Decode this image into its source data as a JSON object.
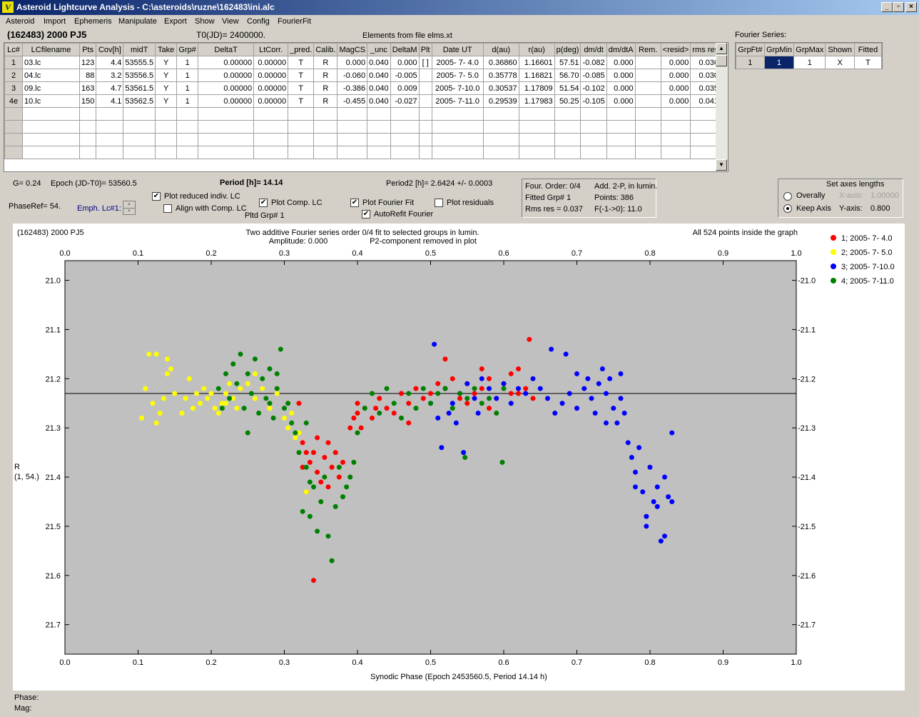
{
  "window": {
    "title": "Asteroid Lightcurve Analysis - C:\\asteroids\\ruzne\\162483\\ini.alc",
    "min": "_",
    "max": "▫",
    "close": "×"
  },
  "menu": [
    "Asteroid",
    "Import",
    "Ephemeris",
    "Manipulate",
    "Export",
    "Show",
    "View",
    "Config",
    "FourierFit"
  ],
  "header": {
    "object": "(162483) 2000 PJ5",
    "t0": "T0(JD)= 2400000.",
    "elements": "Elements from file elms.xt"
  },
  "table": {
    "columns": [
      "Lc#",
      "LCfilename",
      "Pts",
      "Cov[h]",
      "midT",
      "Take",
      "Grp#",
      "DeltaT",
      "LtCorr.",
      "_pred.",
      "Calib.",
      "MagCS",
      "_unc",
      "DeltaM",
      "Plt",
      "Date UT",
      "d(au)",
      "r(au)",
      "p(deg)",
      "dm/dt",
      "dm/dtA",
      "Rem.",
      "<resid>",
      "rms res"
    ],
    "rows": [
      [
        "1",
        "03.lc",
        "123",
        "4.4",
        "53555.5",
        "Y",
        "1",
        "0.00000",
        "0.00000",
        "T",
        "R",
        "0.000",
        "0.040",
        "0.000",
        "[ ]",
        "2005- 7- 4.0",
        "0.36860",
        "1.16601",
        "57.51",
        "-0.082",
        "0.000",
        "",
        "0.000",
        "0.036"
      ],
      [
        "2",
        "04.lc",
        "88",
        "3.2",
        "53556.5",
        "Y",
        "1",
        "0.00000",
        "0.00000",
        "T",
        "R",
        "-0.060",
        "0.040",
        "-0.005",
        "",
        "2005- 7- 5.0",
        "0.35778",
        "1.16821",
        "56.70",
        "-0.085",
        "0.000",
        "",
        "0.000",
        "0.030"
      ],
      [
        "3",
        "09.lc",
        "163",
        "4.7",
        "53561.5",
        "Y",
        "1",
        "0.00000",
        "0.00000",
        "T",
        "R",
        "-0.386",
        "0.040",
        "0.009",
        "",
        "2005- 7-10.0",
        "0.30537",
        "1.17809",
        "51.54",
        "-0.102",
        "0.000",
        "",
        "0.000",
        "0.035"
      ],
      [
        "4e",
        "10.lc",
        "150",
        "4.1",
        "53562.5",
        "Y",
        "1",
        "0.00000",
        "0.00000",
        "T",
        "R",
        "-0.455",
        "0.040",
        "-0.027",
        "",
        "2005- 7-11.0",
        "0.29539",
        "1.17983",
        "50.25",
        "-0.105",
        "0.000",
        "",
        "0.000",
        "0.041"
      ]
    ]
  },
  "fourier": {
    "label": "Fourier Series:",
    "columns": [
      "GrpFt#",
      "GrpMin",
      "GrpMax",
      "Shown",
      "Fitted"
    ],
    "row": [
      "1",
      "1",
      "1",
      "X",
      "T"
    ]
  },
  "controls": {
    "g": "G= 0.24",
    "epoch": "Epoch (JD-T0)= 53560.5",
    "period": "Period [h]= 14.14",
    "period2": "Period2 [h]= 2.6424 +/- 0.0003",
    "phaseref": "PhaseRef= 54.",
    "emph": "Emph. Lc#1:",
    "plot_reduced": "Plot reduced indiv. LC",
    "align": "Align with Comp. LC",
    "plot_comp": "Plot Comp. LC",
    "pltd_grp": "Pltd Grp#  1",
    "plot_fourier": "Plot Fourier Fit",
    "autorefit": "AutoRefit Fourier",
    "plot_resid": "Plot residuals",
    "four_order": "Four. Order:  0/4",
    "add2p": "Add. 2-P, in lumin.",
    "fitted_grp": "Fitted Grp# 1",
    "points": "Points: 386",
    "rms": "Rms res      = 0.037",
    "f10": "F(-1->0):  11.0",
    "axes_title": "Set axes lengths",
    "overally": "Overally",
    "keep_axis": "Keep Axis",
    "xaxis_label": "X-axis:",
    "xaxis_val": "1.00000",
    "yaxis_label": "Y-axis:",
    "yaxis_val": "0.800"
  },
  "plot": {
    "object": "(162483) 2000 PJ5",
    "title1": "Two additive Fourier series order 0/4 fit to selected groups in lumin.",
    "title2": "Amplitude: 0.000",
    "title3": "P2-component removed in plot",
    "inside": "All 524 points inside the graph",
    "ylabel1": "R",
    "ylabel2": "(1, 54.)",
    "xlabel": "Synodic Phase (Epoch 2453560.5, Period 14.14 h)"
  },
  "status": {
    "phase": "Phase:",
    "mag": "Mag:"
  },
  "chart_data": {
    "type": "scatter",
    "xlabel": "Synodic Phase (Epoch 2453560.5, Period 14.14 h)",
    "ylabel": "R (1, 54.)",
    "xlim": [
      0.0,
      1.0
    ],
    "ylim": [
      21.7,
      21.0
    ],
    "xticks": [
      "0.0",
      "0.1",
      "0.2",
      "0.3",
      "0.4",
      "0.5",
      "0.6",
      "0.7",
      "0.8",
      "0.9",
      "1.0"
    ],
    "yticks": [
      "21.0",
      "21.1",
      "21.2",
      "21.3",
      "21.4",
      "21.5",
      "21.6",
      "21.7"
    ],
    "fit_line": 21.23,
    "legend": "top-right",
    "series": [
      {
        "name": "1; 2005- 7- 4.0",
        "color": "#ff0000",
        "points": [
          [
            0.32,
            21.25
          ],
          [
            0.325,
            21.38
          ],
          [
            0.33,
            21.43
          ],
          [
            0.335,
            21.37
          ],
          [
            0.34,
            21.35
          ],
          [
            0.345,
            21.39
          ],
          [
            0.35,
            21.41
          ],
          [
            0.355,
            21.36
          ],
          [
            0.36,
            21.33
          ],
          [
            0.365,
            21.38
          ],
          [
            0.37,
            21.35
          ],
          [
            0.375,
            21.4
          ],
          [
            0.38,
            21.37
          ],
          [
            0.39,
            21.3
          ],
          [
            0.395,
            21.28
          ],
          [
            0.4,
            21.27
          ],
          [
            0.405,
            21.3
          ],
          [
            0.41,
            21.26
          ],
          [
            0.42,
            21.28
          ],
          [
            0.43,
            21.24
          ],
          [
            0.44,
            21.26
          ],
          [
            0.45,
            21.27
          ],
          [
            0.46,
            21.23
          ],
          [
            0.47,
            21.25
          ],
          [
            0.48,
            21.22
          ],
          [
            0.49,
            21.24
          ],
          [
            0.5,
            21.23
          ],
          [
            0.51,
            21.21
          ],
          [
            0.52,
            21.22
          ],
          [
            0.53,
            21.2
          ],
          [
            0.54,
            21.24
          ],
          [
            0.55,
            21.21
          ],
          [
            0.56,
            21.23
          ],
          [
            0.57,
            21.22
          ],
          [
            0.58,
            21.26
          ],
          [
            0.59,
            21.24
          ],
          [
            0.6,
            21.21
          ],
          [
            0.61,
            21.23
          ],
          [
            0.62,
            21.18
          ],
          [
            0.63,
            21.22
          ],
          [
            0.635,
            21.12
          ],
          [
            0.64,
            21.24
          ],
          [
            0.34,
            21.61
          ],
          [
            0.33,
            21.35
          ],
          [
            0.36,
            21.42
          ],
          [
            0.47,
            21.29
          ],
          [
            0.55,
            21.25
          ],
          [
            0.61,
            21.19
          ],
          [
            0.52,
            21.16
          ],
          [
            0.57,
            21.18
          ],
          [
            0.62,
            21.23
          ],
          [
            0.425,
            21.26
          ],
          [
            0.325,
            21.33
          ],
          [
            0.345,
            21.32
          ],
          [
            0.58,
            21.2
          ],
          [
            0.4,
            21.25
          ]
        ]
      },
      {
        "name": "2; 2005- 7- 5.0",
        "color": "#ffff00",
        "points": [
          [
            0.105,
            21.28
          ],
          [
            0.11,
            21.22
          ],
          [
            0.115,
            21.15
          ],
          [
            0.12,
            21.25
          ],
          [
            0.125,
            21.15
          ],
          [
            0.13,
            21.27
          ],
          [
            0.135,
            21.24
          ],
          [
            0.14,
            21.19
          ],
          [
            0.145,
            21.18
          ],
          [
            0.15,
            21.23
          ],
          [
            0.16,
            21.27
          ],
          [
            0.165,
            21.24
          ],
          [
            0.17,
            21.2
          ],
          [
            0.175,
            21.26
          ],
          [
            0.18,
            21.23
          ],
          [
            0.185,
            21.25
          ],
          [
            0.19,
            21.22
          ],
          [
            0.195,
            21.24
          ],
          [
            0.2,
            21.23
          ],
          [
            0.205,
            21.26
          ],
          [
            0.21,
            21.27
          ],
          [
            0.215,
            21.25
          ],
          [
            0.22,
            21.23
          ],
          [
            0.225,
            21.21
          ],
          [
            0.23,
            21.24
          ],
          [
            0.235,
            21.26
          ],
          [
            0.24,
            21.22
          ],
          [
            0.25,
            21.21
          ],
          [
            0.26,
            21.24
          ],
          [
            0.27,
            21.22
          ],
          [
            0.28,
            21.26
          ],
          [
            0.29,
            21.23
          ],
          [
            0.3,
            21.28
          ],
          [
            0.305,
            21.3
          ],
          [
            0.31,
            21.27
          ],
          [
            0.315,
            21.32
          ],
          [
            0.32,
            21.31
          ],
          [
            0.33,
            21.43
          ],
          [
            0.125,
            21.29
          ],
          [
            0.14,
            21.16
          ],
          [
            0.22,
            21.25
          ],
          [
            0.26,
            21.19
          ]
        ]
      },
      {
        "name": "3; 2005- 7-10.0",
        "color": "#0000ff",
        "points": [
          [
            0.5,
            21.25
          ],
          [
            0.505,
            21.13
          ],
          [
            0.51,
            21.28
          ],
          [
            0.515,
            21.34
          ],
          [
            0.52,
            21.22
          ],
          [
            0.525,
            21.27
          ],
          [
            0.53,
            21.25
          ],
          [
            0.535,
            21.29
          ],
          [
            0.54,
            21.23
          ],
          [
            0.545,
            21.35
          ],
          [
            0.55,
            21.21
          ],
          [
            0.56,
            21.24
          ],
          [
            0.565,
            21.27
          ],
          [
            0.57,
            21.2
          ],
          [
            0.58,
            21.22
          ],
          [
            0.59,
            21.24
          ],
          [
            0.6,
            21.21
          ],
          [
            0.61,
            21.25
          ],
          [
            0.62,
            21.22
          ],
          [
            0.63,
            21.23
          ],
          [
            0.64,
            21.2
          ],
          [
            0.65,
            21.22
          ],
          [
            0.66,
            21.24
          ],
          [
            0.665,
            21.14
          ],
          [
            0.67,
            21.27
          ],
          [
            0.68,
            21.25
          ],
          [
            0.685,
            21.15
          ],
          [
            0.69,
            21.23
          ],
          [
            0.7,
            21.26
          ],
          [
            0.71,
            21.22
          ],
          [
            0.715,
            21.2
          ],
          [
            0.72,
            21.24
          ],
          [
            0.725,
            21.27
          ],
          [
            0.73,
            21.21
          ],
          [
            0.735,
            21.18
          ],
          [
            0.74,
            21.23
          ],
          [
            0.745,
            21.2
          ],
          [
            0.75,
            21.26
          ],
          [
            0.755,
            21.29
          ],
          [
            0.76,
            21.24
          ],
          [
            0.765,
            21.27
          ],
          [
            0.77,
            21.33
          ],
          [
            0.775,
            21.36
          ],
          [
            0.78,
            21.39
          ],
          [
            0.785,
            21.34
          ],
          [
            0.79,
            21.43
          ],
          [
            0.795,
            21.48
          ],
          [
            0.8,
            21.38
          ],
          [
            0.805,
            21.45
          ],
          [
            0.81,
            21.42
          ],
          [
            0.815,
            21.53
          ],
          [
            0.82,
            21.4
          ],
          [
            0.825,
            21.44
          ],
          [
            0.83,
            21.31
          ],
          [
            0.795,
            21.5
          ],
          [
            0.81,
            21.46
          ],
          [
            0.82,
            21.52
          ],
          [
            0.83,
            21.45
          ],
          [
            0.74,
            21.29
          ],
          [
            0.76,
            21.19
          ],
          [
            0.78,
            21.42
          ],
          [
            0.7,
            21.19
          ]
        ]
      },
      {
        "name": "4; 2005- 7-11.0",
        "color": "#008000",
        "points": [
          [
            0.21,
            21.22
          ],
          [
            0.215,
            21.26
          ],
          [
            0.22,
            21.19
          ],
          [
            0.225,
            21.24
          ],
          [
            0.23,
            21.17
          ],
          [
            0.235,
            21.21
          ],
          [
            0.24,
            21.15
          ],
          [
            0.245,
            21.26
          ],
          [
            0.25,
            21.19
          ],
          [
            0.255,
            21.23
          ],
          [
            0.26,
            21.16
          ],
          [
            0.265,
            21.27
          ],
          [
            0.27,
            21.2
          ],
          [
            0.275,
            21.24
          ],
          [
            0.28,
            21.18
          ],
          [
            0.285,
            21.28
          ],
          [
            0.29,
            21.22
          ],
          [
            0.295,
            21.14
          ],
          [
            0.3,
            21.26
          ],
          [
            0.305,
            21.25
          ],
          [
            0.31,
            21.29
          ],
          [
            0.315,
            21.31
          ],
          [
            0.32,
            21.35
          ],
          [
            0.325,
            21.47
          ],
          [
            0.33,
            21.38
          ],
          [
            0.335,
            21.48
          ],
          [
            0.34,
            21.42
          ],
          [
            0.345,
            21.51
          ],
          [
            0.35,
            21.45
          ],
          [
            0.355,
            21.4
          ],
          [
            0.36,
            21.52
          ],
          [
            0.365,
            21.57
          ],
          [
            0.37,
            21.46
          ],
          [
            0.375,
            21.38
          ],
          [
            0.38,
            21.44
          ],
          [
            0.385,
            21.42
          ],
          [
            0.39,
            21.4
          ],
          [
            0.395,
            21.37
          ],
          [
            0.4,
            21.31
          ],
          [
            0.41,
            21.26
          ],
          [
            0.42,
            21.23
          ],
          [
            0.43,
            21.27
          ],
          [
            0.44,
            21.22
          ],
          [
            0.45,
            21.25
          ],
          [
            0.46,
            21.28
          ],
          [
            0.47,
            21.23
          ],
          [
            0.48,
            21.26
          ],
          [
            0.49,
            21.22
          ],
          [
            0.5,
            21.25
          ],
          [
            0.51,
            21.23
          ],
          [
            0.52,
            21.22
          ],
          [
            0.53,
            21.26
          ],
          [
            0.54,
            21.23
          ],
          [
            0.547,
            21.36
          ],
          [
            0.55,
            21.24
          ],
          [
            0.56,
            21.22
          ],
          [
            0.57,
            21.25
          ],
          [
            0.58,
            21.24
          ],
          [
            0.59,
            21.27
          ],
          [
            0.598,
            21.37
          ],
          [
            0.6,
            21.22
          ],
          [
            0.25,
            21.31
          ],
          [
            0.28,
            21.25
          ],
          [
            0.335,
            21.41
          ],
          [
            0.29,
            21.19
          ],
          [
            0.33,
            21.29
          ]
        ]
      }
    ]
  }
}
